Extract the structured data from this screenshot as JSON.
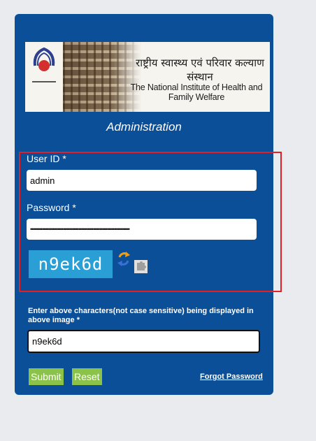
{
  "banner": {
    "hindi_title": "राष्ट्रीय स्वास्थ्य एवं परिवार कल्याण संस्थान",
    "english_title": "The National Institute of Health and Family Welfare"
  },
  "form": {
    "heading": "Administration",
    "userid_label": "User ID *",
    "userid_value": "admin",
    "password_label": "Password *",
    "password_value": "••••••••••••••••••••••••••••••••••••••••••••••••••••••••••••••••••",
    "captcha_text": "n9ek6d",
    "captcha_instruction": "Enter above characters(not case sensitive) being displayed in above image *",
    "captcha_input_value": "n9ek6d",
    "submit_label": "Submit",
    "reset_label": "Reset",
    "forgot_label": "Forgot Password"
  },
  "colors": {
    "panel": "#0a4f98",
    "highlight_border": "#e31e24",
    "button": "#8bc34a",
    "captcha_bg": "#2a9fd6"
  },
  "icons": [
    "refresh-icon",
    "puzzle-icon"
  ]
}
